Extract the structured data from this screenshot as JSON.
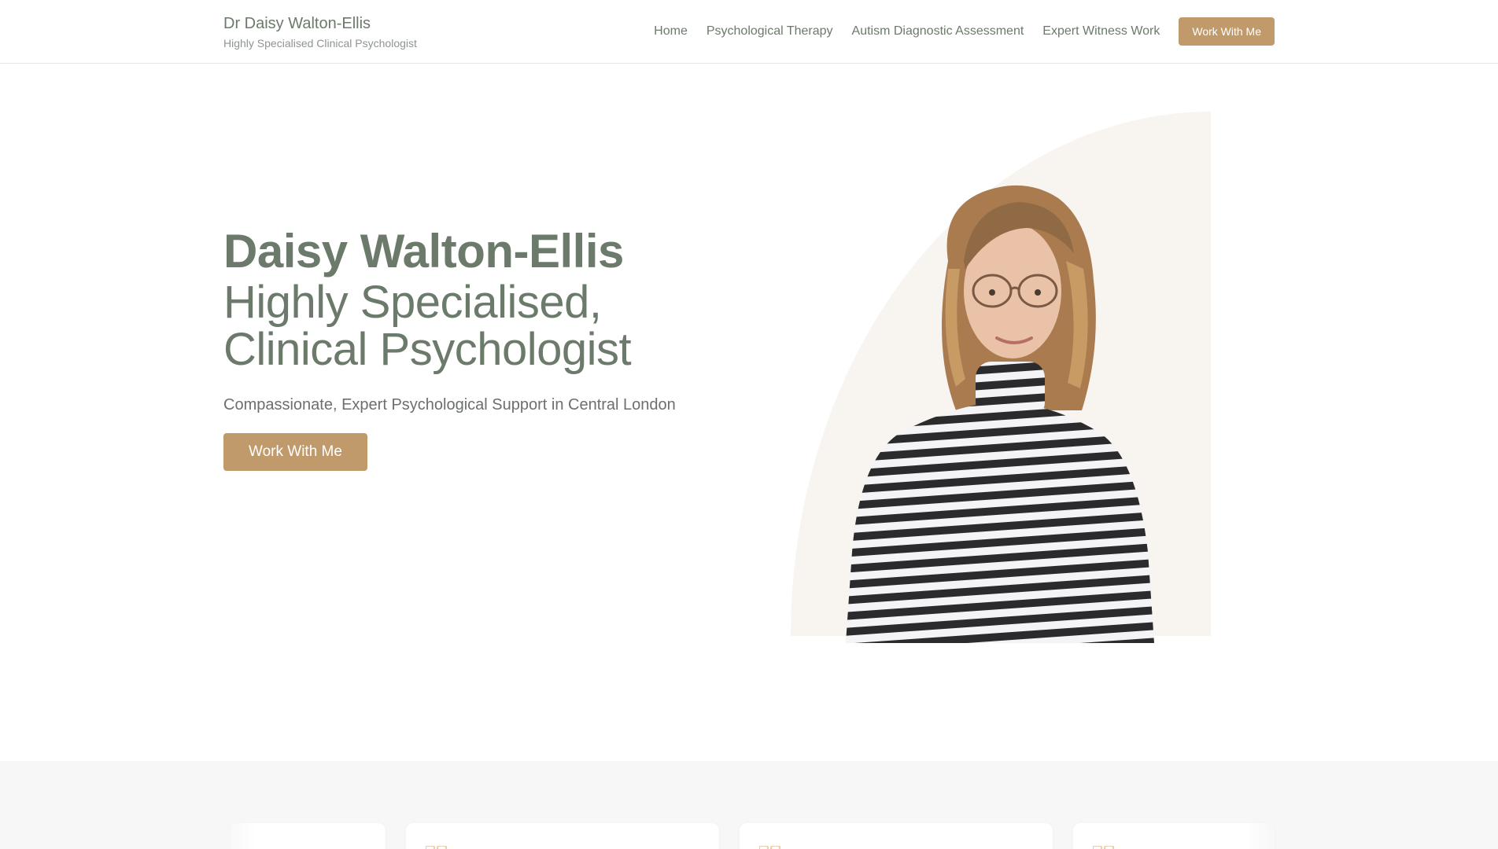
{
  "header": {
    "brand_name": "Dr Daisy Walton-Ellis",
    "brand_subtitle": "Highly Specialised Clinical Psychologist",
    "nav": [
      {
        "label": "Home"
      },
      {
        "label": "Psychological Therapy"
      },
      {
        "label": "Autism Diagnostic Assessment"
      },
      {
        "label": "Expert Witness Work"
      }
    ],
    "cta_label": "Work With Me"
  },
  "hero": {
    "name": "Daisy Walton-Ellis",
    "title_line1": "Highly Specialised,",
    "title_line2": "Clinical Psychologist",
    "tagline": "Compassionate, Expert Psychological Support in Central London",
    "cta_label": "Work With Me"
  },
  "colors": {
    "accent": "#c19a6b",
    "text_green": "#6b7a6a",
    "portrait_bg": "#f8f5f1",
    "section_bg": "#f7f7f7"
  },
  "testimonials": {
    "icon": "quote-icon"
  }
}
